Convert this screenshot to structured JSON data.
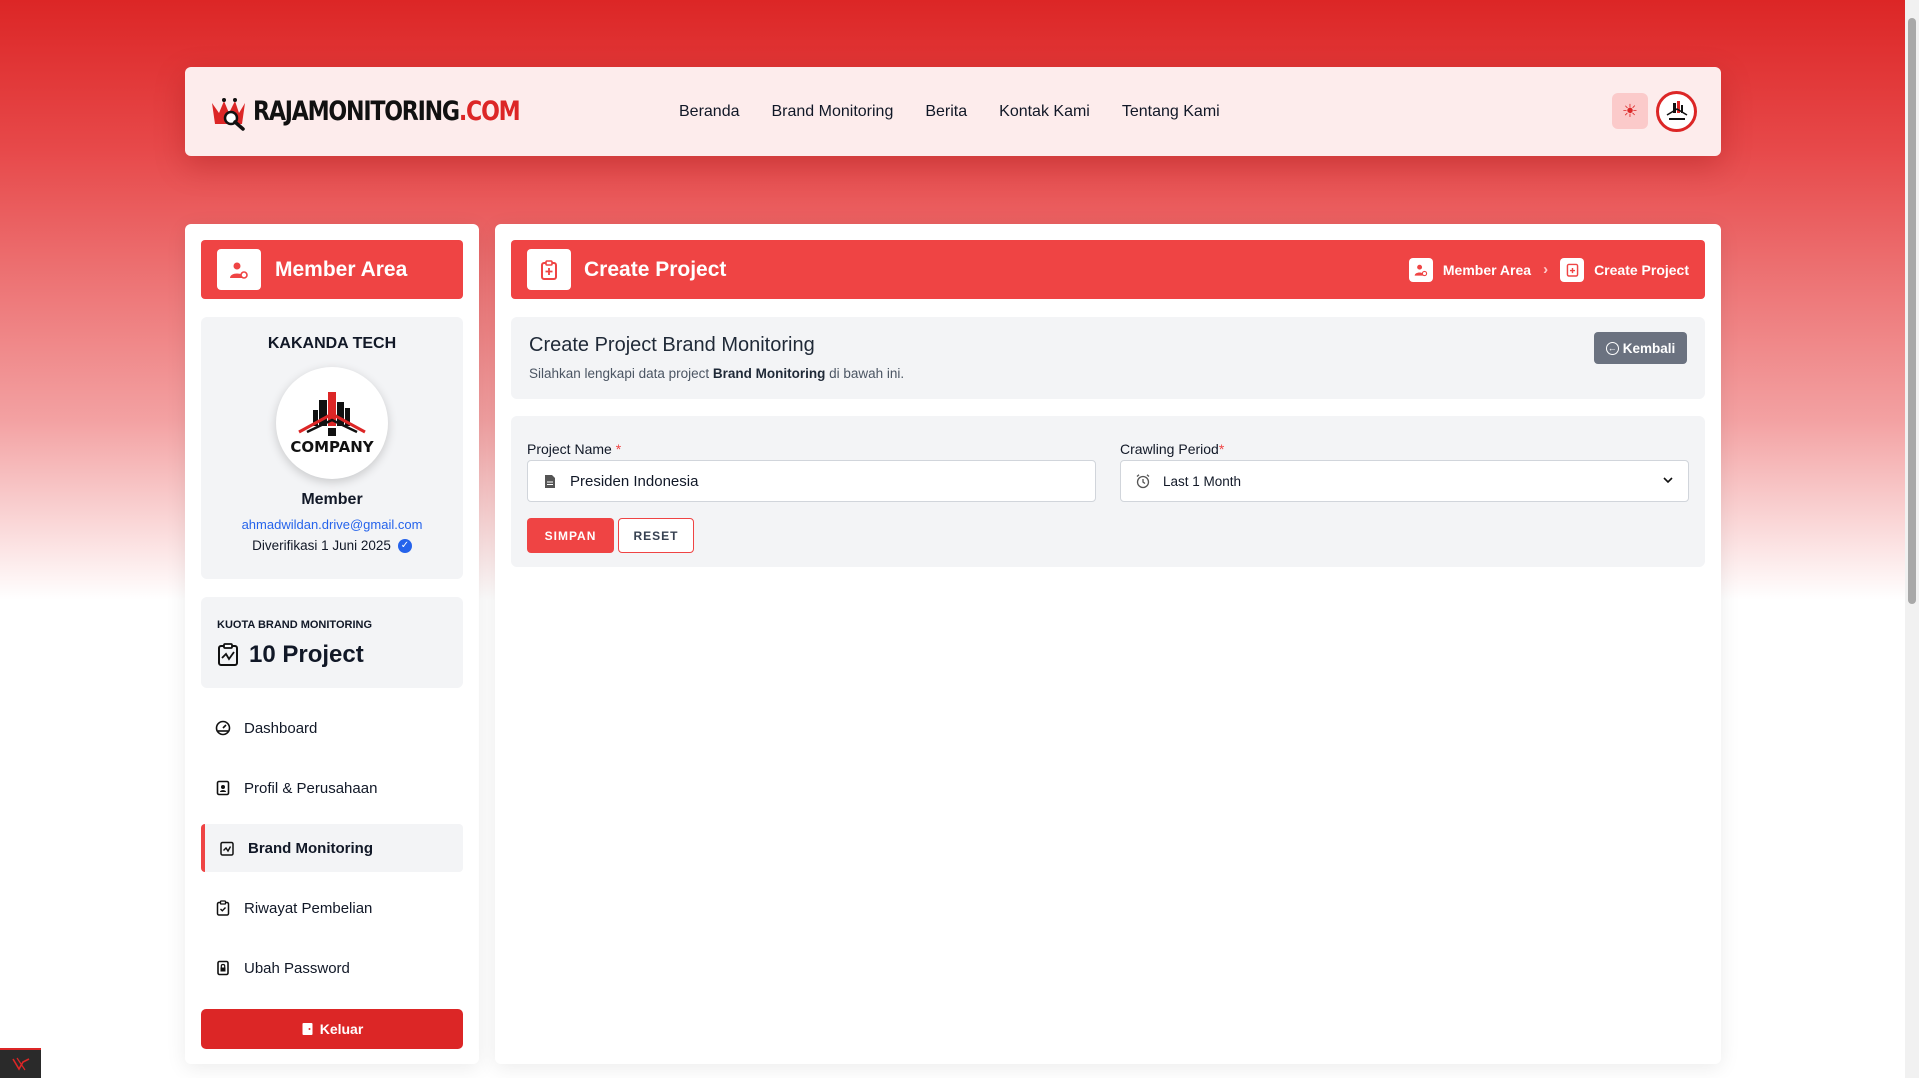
{
  "brand": {
    "name_part1": "RAJAMONITORING",
    "name_part2": ".COM",
    "accent": "#dc2626"
  },
  "nav": {
    "links": [
      {
        "label": "Beranda"
      },
      {
        "label": "Brand Monitoring"
      },
      {
        "label": "Berita"
      },
      {
        "label": "Kontak Kami"
      },
      {
        "label": "Tentang Kami"
      }
    ],
    "theme_icon": "sun-icon",
    "avatar_icon": "company-avatar"
  },
  "sidebar": {
    "header_title": "Member Area",
    "profile": {
      "company_name": "KAKANDA TECH",
      "logo_text": "COMPANY",
      "role": "Member",
      "email": "ahmadwildan.drive@gmail.com",
      "verified_text": "Diverifikasi 1 Juni 2025"
    },
    "quota": {
      "label": "KUOTA BRAND MONITORING",
      "value": "10 Project"
    },
    "menu": [
      {
        "label": "Dashboard",
        "icon": "dashboard-icon"
      },
      {
        "label": "Profil & Perusahaan",
        "icon": "profile-icon"
      },
      {
        "label": "Brand Monitoring",
        "icon": "brand-monitoring-icon",
        "active": true
      },
      {
        "label": "Riwayat Pembelian",
        "icon": "history-icon"
      },
      {
        "label": "Ubah Password",
        "icon": "lock-icon"
      }
    ],
    "logout_label": "Keluar"
  },
  "main": {
    "header_title": "Create Project",
    "breadcrumb": [
      "Member Area",
      "Create Project"
    ],
    "intro": {
      "title": "Create Project Brand Monitoring",
      "sub_prefix": "Silahkan lengkapi data project ",
      "sub_bold": "Brand Monitoring",
      "sub_suffix": " di bawah ini."
    },
    "back_label": "Kembali",
    "form": {
      "project_name_label": "Project Name",
      "project_name_value": "Presiden Indonesia",
      "crawling_label": "Crawling Period",
      "crawling_value": "Last 1 Month",
      "required_mark": "*",
      "save_label": "SIMPAN",
      "reset_label": "RESET"
    }
  }
}
